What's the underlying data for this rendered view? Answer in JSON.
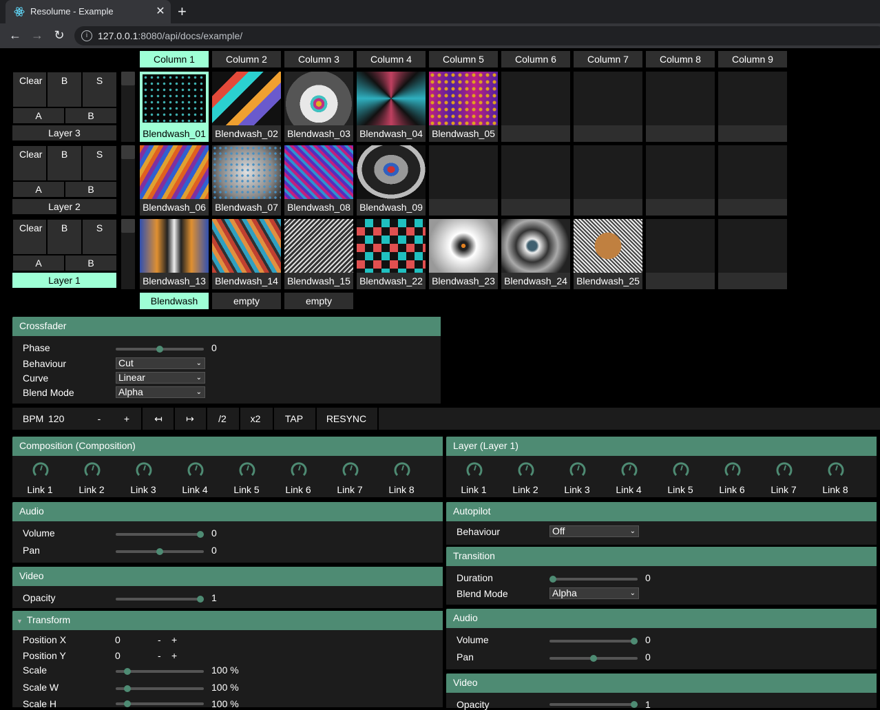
{
  "browser": {
    "tab_title": "Resolume - Example",
    "tab_close": "✕",
    "new_tab": "+",
    "back": "←",
    "forward": "→",
    "reload": "↻",
    "url_host": "127.0.0.1",
    "url_rest": ":8080/api/docs/example/"
  },
  "columns": [
    "Column 1",
    "Column 2",
    "Column 3",
    "Column 4",
    "Column 5",
    "Column 6",
    "Column 7",
    "Column 8",
    "Column 9"
  ],
  "layers": [
    {
      "name": "Layer 3",
      "clear": "Clear",
      "b": "B",
      "s": "S",
      "a": "A",
      "b2": "B",
      "clips": [
        "Blendwash_01",
        "Blendwash_02",
        "Blendwash_03",
        "Blendwash_04",
        "Blendwash_05",
        "",
        "",
        "",
        ""
      ]
    },
    {
      "name": "Layer 2",
      "clear": "Clear",
      "b": "B",
      "s": "S",
      "a": "A",
      "b2": "B",
      "clips": [
        "Blendwash_06",
        "Blendwash_07",
        "Blendwash_08",
        "Blendwash_09",
        "",
        "",
        "",
        "",
        ""
      ]
    },
    {
      "name": "Layer 1",
      "clear": "Clear",
      "b": "B",
      "s": "S",
      "a": "A",
      "b2": "B",
      "clips": [
        "Blendwash_13",
        "Blendwash_14",
        "Blendwash_15",
        "Blendwash_22",
        "Blendwash_23",
        "Blendwash_24",
        "Blendwash_25",
        "",
        ""
      ]
    }
  ],
  "decks": [
    "Blendwash",
    "empty",
    "empty"
  ],
  "crossfader": {
    "title": "Crossfader",
    "phase_label": "Phase",
    "phase_value": "0",
    "phase_level": 0.5,
    "behaviour_label": "Behaviour",
    "behaviour_value": "Cut",
    "curve_label": "Curve",
    "curve_value": "Linear",
    "blend_label": "Blend Mode",
    "blend_value": "Alpha"
  },
  "bpm": {
    "label": "BPM",
    "value": "120",
    "minus": "-",
    "plus": "+",
    "nudge_left": "↤",
    "nudge_right": "↦",
    "half": "/2",
    "double": "x2",
    "tap": "TAP",
    "resync": "RESYNC"
  },
  "composition": {
    "title": "Composition (Composition)",
    "links": [
      "Link 1",
      "Link 2",
      "Link 3",
      "Link 4",
      "Link 5",
      "Link 6",
      "Link 7",
      "Link 8"
    ],
    "audio": {
      "title": "Audio",
      "volume_label": "Volume",
      "volume_value": "0",
      "volume_level": 1.0,
      "pan_label": "Pan",
      "pan_value": "0",
      "pan_level": 0.5
    },
    "video": {
      "title": "Video",
      "opacity_label": "Opacity",
      "opacity_value": "1",
      "opacity_level": 1.0
    },
    "transform": {
      "title": "Transform",
      "collapse_icon": "▼",
      "posx_label": "Position X",
      "posx_value": "0",
      "posy_label": "Position Y",
      "posy_value": "0",
      "minus": "-",
      "plus": "+",
      "scale_label": "Scale",
      "scale_value": "100 %",
      "scale_level": 0.1,
      "scalew_label": "Scale W",
      "scalew_value": "100 %",
      "scalew_level": 0.1,
      "scaleh_label": "Scale H",
      "scaleh_value": "100 %",
      "scaleh_level": 0.1
    }
  },
  "layer": {
    "title": "Layer (Layer 1)",
    "links": [
      "Link 1",
      "Link 2",
      "Link 3",
      "Link 4",
      "Link 5",
      "Link 6",
      "Link 7",
      "Link 8"
    ],
    "autopilot": {
      "title": "Autopilot",
      "behaviour_label": "Behaviour",
      "behaviour_value": "Off"
    },
    "transition": {
      "title": "Transition",
      "duration_label": "Duration",
      "duration_value": "0",
      "duration_level": 0.0,
      "blend_label": "Blend Mode",
      "blend_value": "Alpha"
    },
    "audio": {
      "title": "Audio",
      "volume_label": "Volume",
      "volume_value": "0",
      "volume_level": 1.0,
      "pan_label": "Pan",
      "pan_value": "0",
      "pan_level": 0.5
    },
    "video": {
      "title": "Video",
      "opacity_label": "Opacity",
      "opacity_value": "1",
      "opacity_level": 1.0
    }
  },
  "colors": {
    "accent": "#4e8b73",
    "active": "#9effd6",
    "panel": "#1c1c1c",
    "cell": "#2e2e2e"
  }
}
